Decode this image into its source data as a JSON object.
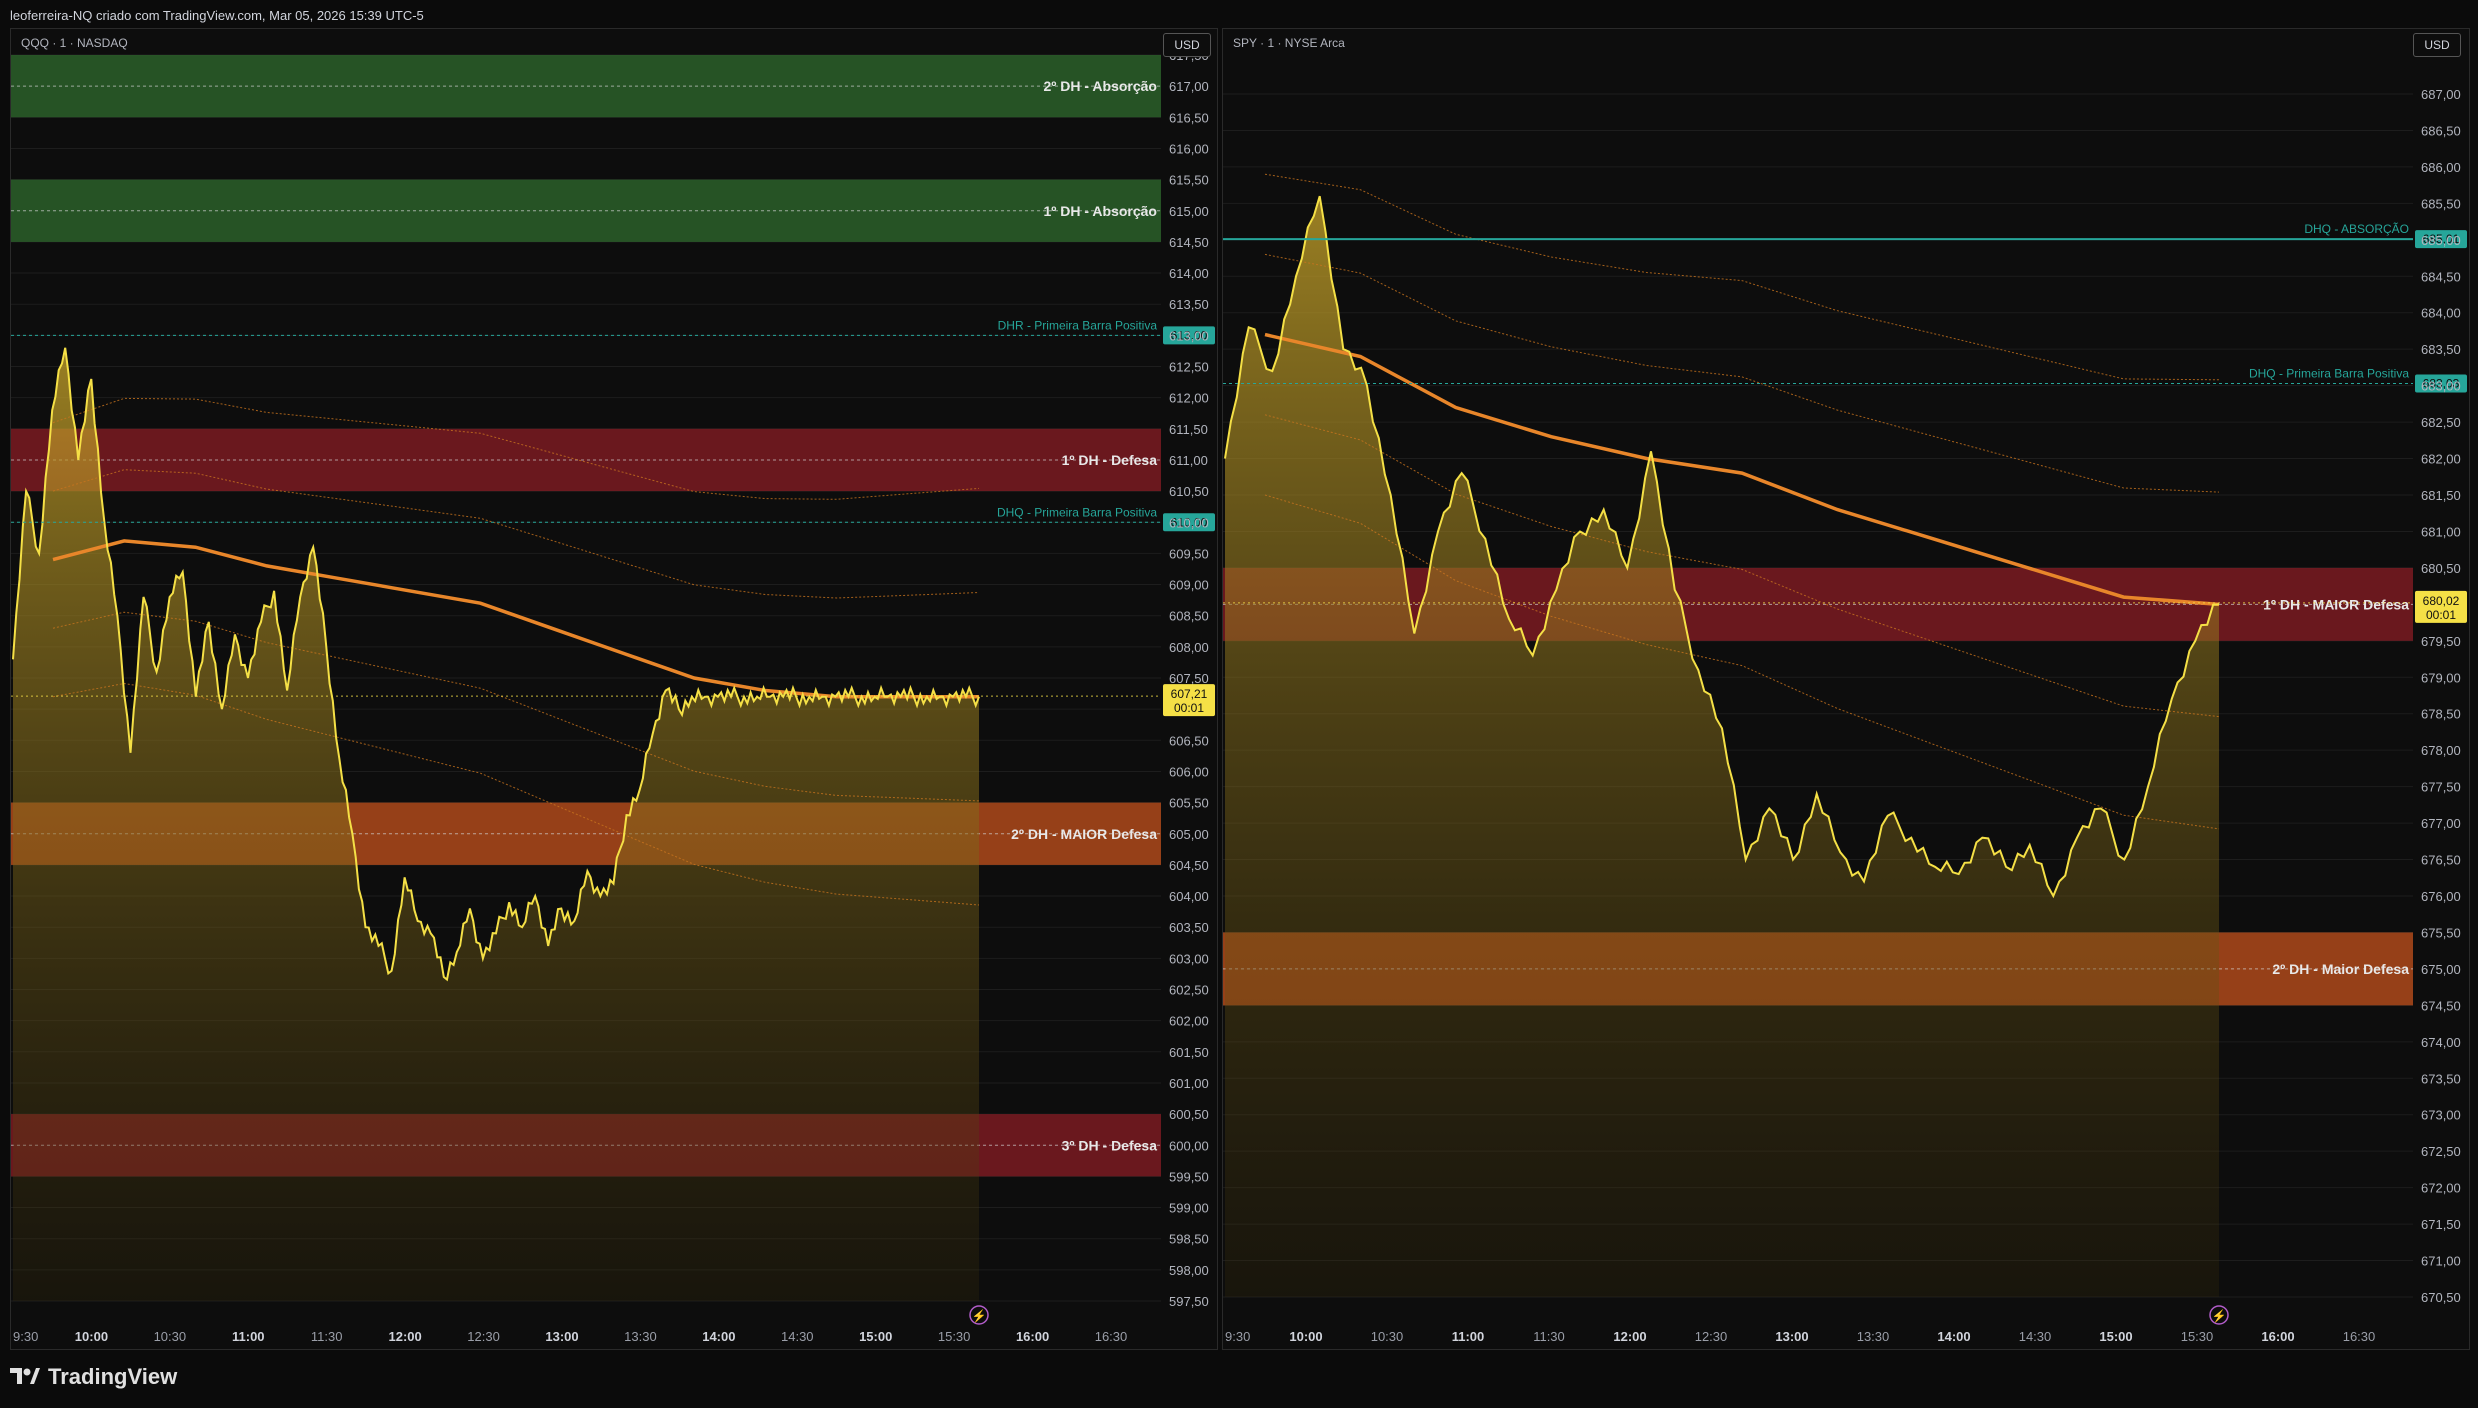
{
  "header": {
    "text": "leoferreira-NQ criado com TradingView.com, Mar 05, 2026 15:39 UTC-5"
  },
  "footer": {
    "brand": "TradingView"
  },
  "colors": {
    "price_line": "#f5e046",
    "vwap": "#e8862a",
    "band": "#c9741e",
    "green_zone": "#2f6b2e",
    "red_zone": "#8a1c24",
    "orange_zone": "#c4521c",
    "teal": "#26a69a",
    "yellow_tag": "#f5e046"
  },
  "chart_data": [
    {
      "type": "line",
      "symbol": "QQQ · 1 · NASDAQ",
      "currency": "USD",
      "ylim": [
        597.5,
        617.5
      ],
      "y_ticks": [
        "617,50",
        "617,00",
        "616,50",
        "616,00",
        "615,50",
        "615,00",
        "614,50",
        "614,00",
        "613,50",
        "613,00",
        "612,50",
        "612,00",
        "611,50",
        "611,00",
        "610,50",
        "610,00",
        "609,50",
        "609,00",
        "608,50",
        "608,00",
        "607,50",
        "607,00",
        "606,50",
        "606,00",
        "605,50",
        "605,00",
        "604,50",
        "604,00",
        "603,50",
        "603,00",
        "602,50",
        "602,00",
        "601,50",
        "601,00",
        "600,50",
        "600,00",
        "599,50",
        "599,00",
        "598,50",
        "598,00",
        "597,50"
      ],
      "x_ticks": [
        {
          "label": "9:30",
          "bold": false
        },
        {
          "label": "10:00",
          "bold": true
        },
        {
          "label": "10:30",
          "bold": false
        },
        {
          "label": "11:00",
          "bold": true
        },
        {
          "label": "11:30",
          "bold": false
        },
        {
          "label": "12:00",
          "bold": true
        },
        {
          "label": "12:30",
          "bold": false
        },
        {
          "label": "13:00",
          "bold": true
        },
        {
          "label": "13:30",
          "bold": false
        },
        {
          "label": "14:00",
          "bold": true
        },
        {
          "label": "14:30",
          "bold": false
        },
        {
          "label": "15:00",
          "bold": true
        },
        {
          "label": "15:30",
          "bold": false
        },
        {
          "label": "16:00",
          "bold": true
        },
        {
          "label": "16:30",
          "bold": false
        }
      ],
      "last_price": {
        "value": "607,21",
        "timer": "00:01"
      },
      "zones": [
        {
          "label": "2º DH - Absorção",
          "low": 616.5,
          "high": 617.5,
          "color": "green"
        },
        {
          "label": "1º DH - Absorção",
          "low": 614.5,
          "high": 615.5,
          "color": "green"
        },
        {
          "label": "1º DH - Defesa",
          "low": 610.5,
          "high": 611.5,
          "color": "red"
        },
        {
          "label": "2º DH - MAIOR Defesa",
          "low": 604.5,
          "high": 605.5,
          "color": "orange"
        },
        {
          "label": "3º DH - Defesa",
          "low": 599.5,
          "high": 600.5,
          "color": "red"
        }
      ],
      "levels": [
        {
          "label": "DHR - Primeira Barra Positiva",
          "value": 613.0,
          "tag": "613,00"
        },
        {
          "label": "DHQ - Primeira Barra Positiva",
          "value": 610.0,
          "tag": "610,00"
        }
      ],
      "x": [
        0,
        5,
        10,
        15,
        20,
        25,
        30,
        35,
        40,
        45,
        50,
        55,
        60,
        65,
        70,
        75,
        80,
        85,
        90,
        95,
        100,
        105,
        110,
        115,
        120,
        125,
        130,
        135,
        140,
        145,
        150,
        155,
        160,
        165,
        170,
        175,
        180,
        185,
        190,
        195,
        200,
        205,
        210,
        215,
        220,
        225,
        230,
        235,
        240,
        245,
        250,
        255,
        260,
        265,
        270,
        275,
        280,
        285,
        290,
        295,
        300,
        305,
        310,
        315,
        320,
        325,
        330,
        335,
        340,
        345,
        350,
        355,
        360,
        365,
        370
      ],
      "values": [
        607.8,
        610.5,
        609.5,
        611.8,
        612.8,
        611.0,
        612.3,
        610.0,
        608.5,
        606.3,
        608.8,
        607.6,
        608.8,
        609.2,
        607.2,
        608.4,
        607.0,
        608.2,
        607.5,
        608.4,
        608.9,
        607.3,
        608.8,
        609.6,
        608.0,
        606.2,
        605.0,
        603.5,
        603.2,
        602.8,
        604.3,
        603.6,
        603.4,
        602.7,
        603.1,
        603.8,
        603.0,
        603.4,
        603.9,
        603.5,
        604.0,
        603.2,
        603.8,
        603.6,
        604.4,
        604.0,
        604.2,
        605.3,
        605.7,
        606.6,
        607.3,
        607.0,
        607.2,
        607.2,
        607.2,
        607.2,
        607.2,
        607.2,
        607.2,
        607.2,
        607.2,
        607.2,
        607.2,
        607.2,
        607.2,
        607.2,
        607.2,
        607.2,
        607.2,
        607.2,
        607.2,
        607.2,
        607.2,
        607.2,
        607.2
      ],
      "vwap": [
        609.4,
        609.7,
        609.6,
        609.3,
        609.1,
        608.9,
        608.7,
        608.3,
        607.9,
        607.5,
        607.3,
        607.2,
        607.2,
        607.2
      ],
      "vwap_x": [
        30,
        50,
        70,
        90,
        110,
        130,
        150,
        170,
        190,
        210,
        230,
        250,
        270,
        290
      ]
    },
    {
      "type": "line",
      "symbol": "SPY · 1 · NYSE Arca",
      "currency": "USD",
      "ylim": [
        670.5,
        687.0
      ],
      "y_ticks": [
        "687,00",
        "686,50",
        "686,00",
        "685,50",
        "685,00",
        "684,50",
        "684,00",
        "683,50",
        "683,00",
        "682,50",
        "682,00",
        "681,50",
        "681,00",
        "680,50",
        "680,00",
        "679,50",
        "679,00",
        "678,50",
        "678,00",
        "677,50",
        "677,00",
        "676,50",
        "676,00",
        "675,50",
        "675,00",
        "674,50",
        "674,00",
        "673,50",
        "673,00",
        "672,50",
        "672,00",
        "671,50",
        "671,00",
        "670,50"
      ],
      "x_ticks": [
        {
          "label": "9:30",
          "bold": false
        },
        {
          "label": "10:00",
          "bold": true
        },
        {
          "label": "10:30",
          "bold": false
        },
        {
          "label": "11:00",
          "bold": true
        },
        {
          "label": "11:30",
          "bold": false
        },
        {
          "label": "12:00",
          "bold": true
        },
        {
          "label": "12:30",
          "bold": false
        },
        {
          "label": "13:00",
          "bold": true
        },
        {
          "label": "13:30",
          "bold": false
        },
        {
          "label": "14:00",
          "bold": true
        },
        {
          "label": "14:30",
          "bold": false
        },
        {
          "label": "15:00",
          "bold": true
        },
        {
          "label": "15:30",
          "bold": false
        },
        {
          "label": "16:00",
          "bold": true
        },
        {
          "label": "16:30",
          "bold": false
        }
      ],
      "last_price": {
        "value": "680,02",
        "timer": "00:01"
      },
      "zones": [
        {
          "label": "1º DH - MAIOR Defesa",
          "low": 679.5,
          "high": 680.5,
          "color": "red"
        },
        {
          "label": "2º DH - Maior Defesa",
          "low": 674.5,
          "high": 675.5,
          "color": "orange"
        }
      ],
      "levels": [
        {
          "label": "DHQ - ABSORÇÃO",
          "value": 685.01,
          "tag": "685,01"
        },
        {
          "label": "DHQ - Primeira Barra Positiva",
          "value": 683.03,
          "tag": "683,03"
        }
      ],
      "values": [
        682.0,
        683.8,
        683.2,
        684.5,
        685.6,
        683.5,
        683.0,
        681.5,
        679.6,
        681.0,
        681.8,
        680.9,
        679.8,
        679.3,
        680.2,
        681.0,
        681.3,
        680.5,
        682.1,
        680.2,
        679.1,
        678.3,
        676.5,
        677.2,
        676.5,
        677.4,
        676.6,
        676.2,
        677.1,
        676.8,
        676.4,
        676.3,
        676.8,
        676.4,
        676.7,
        676.0,
        676.8,
        677.2,
        676.5,
        677.5,
        678.7,
        679.5,
        680.0
      ],
      "vwap": [
        683.7,
        683.4,
        682.7,
        682.3,
        682.0,
        681.8,
        681.3,
        680.9,
        680.5,
        680.1,
        680.0
      ]
    }
  ]
}
